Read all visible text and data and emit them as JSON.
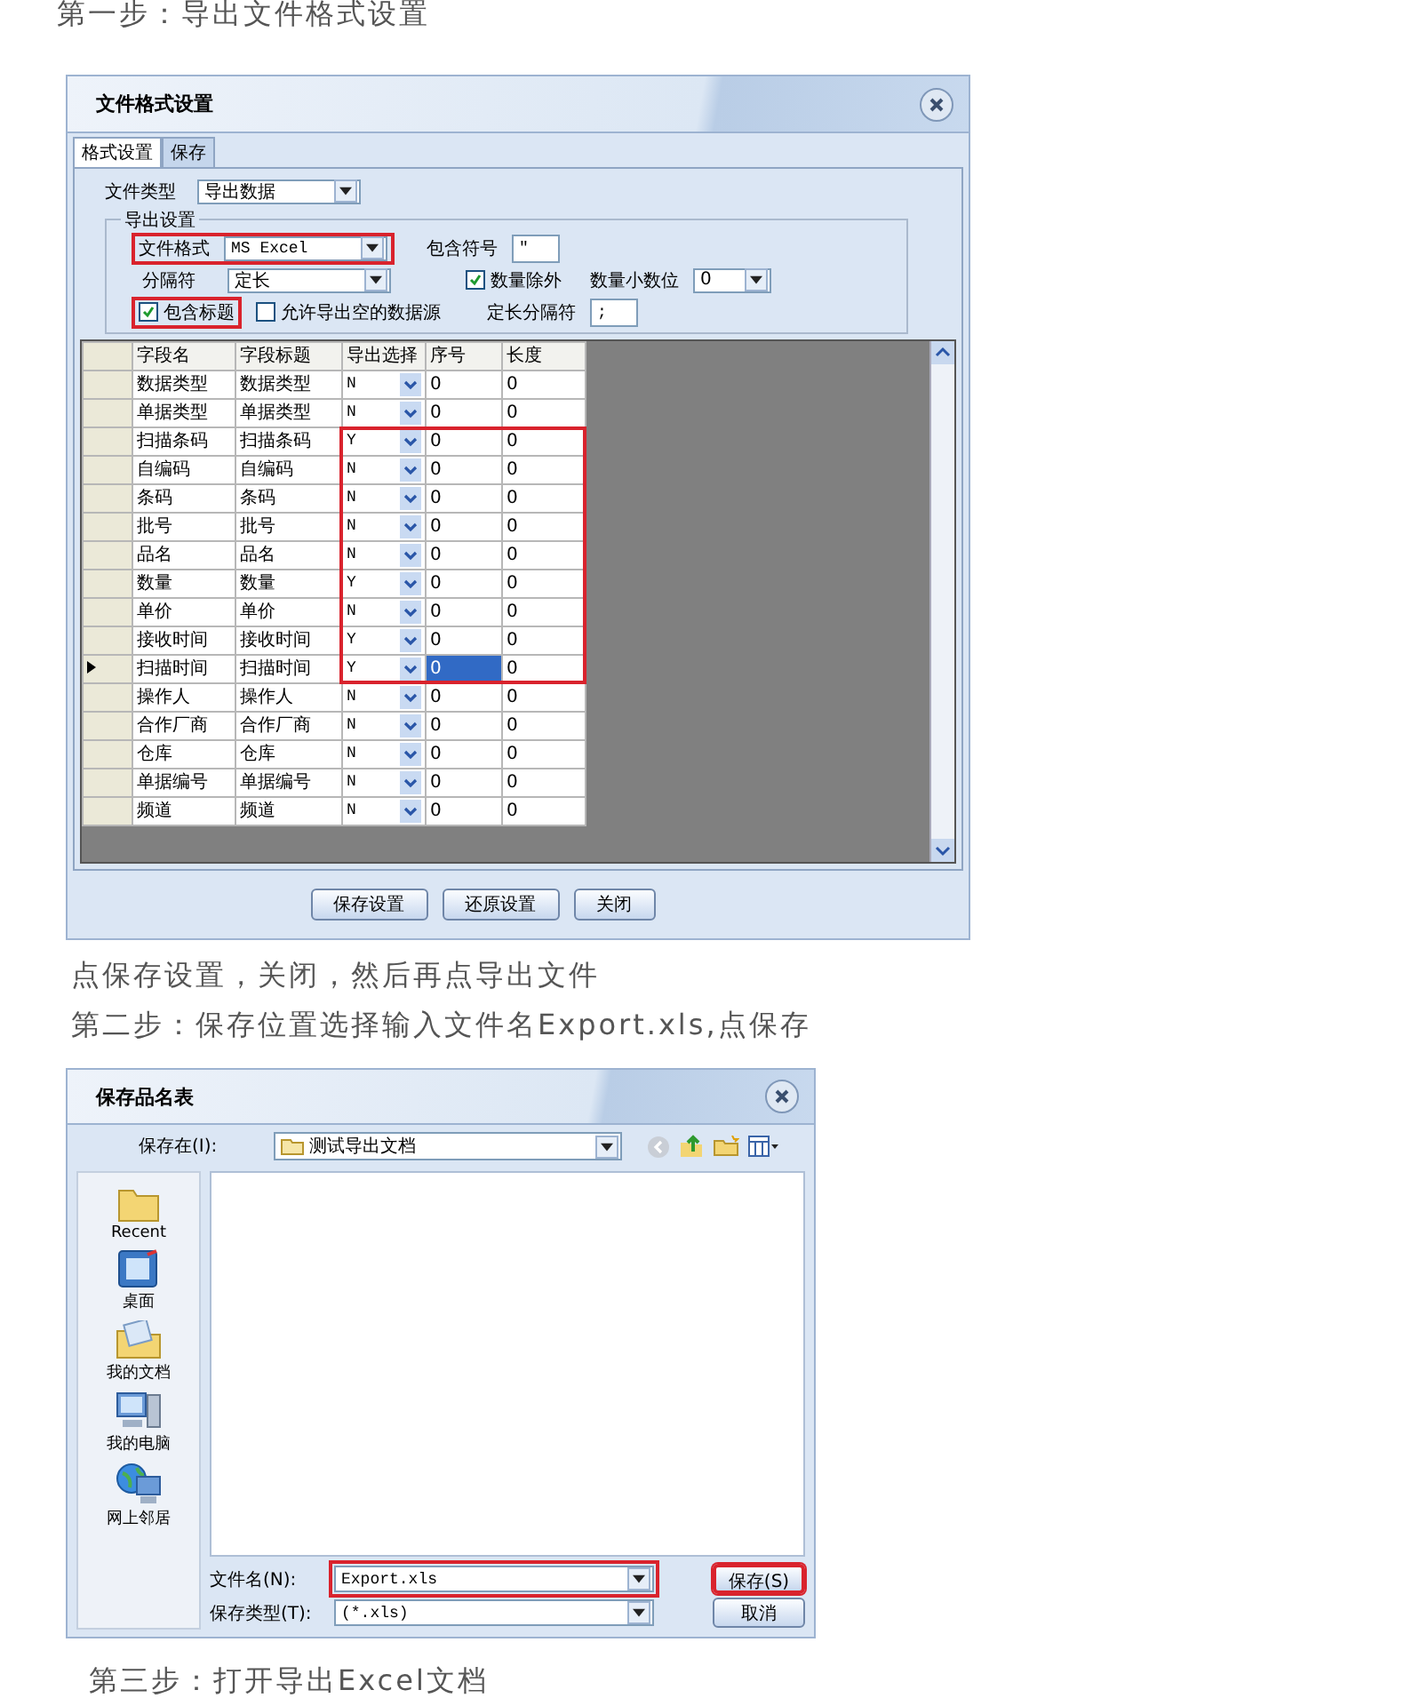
{
  "step1_heading": "第一步：导出文件格式设置",
  "export_dialog": {
    "title": "文件格式设置",
    "tabs": [
      {
        "label": "格式设置",
        "selected": true
      },
      {
        "label": "保存",
        "selected": false
      }
    ],
    "file_type": {
      "label": "文件类型",
      "value": "导出数据"
    },
    "export_settings": {
      "title": "导出设置",
      "file_format": {
        "label": "文件格式",
        "value": "MS Excel",
        "highlighted": true
      },
      "enclosure": {
        "label": "包含符号",
        "value": "\""
      },
      "separator": {
        "label": "分隔符",
        "value": "定长"
      },
      "exclude_quantity": {
        "label": "数量除外",
        "checked": true
      },
      "decimals": {
        "label": "数量小数位",
        "value": "0"
      },
      "include_header": {
        "label": "包含标题",
        "checked": true,
        "highlighted": true
      },
      "allow_empty": {
        "label": "允许导出空的数据源",
        "checked": false
      },
      "fixed_separator": {
        "label": "定长分隔符",
        "value": ";"
      }
    },
    "grid": {
      "columns": [
        "字段名",
        "字段标题",
        "导出选择",
        "序号",
        "长度"
      ],
      "rows": [
        {
          "kind": "row",
          "field": "数据类型",
          "title": "数据类型",
          "export": "N",
          "seq": "0",
          "length": "0",
          "selected": false
        },
        {
          "kind": "row",
          "field": "单据类型",
          "title": "单据类型",
          "export": "N",
          "seq": "0",
          "length": "0",
          "selected": false
        },
        {
          "kind": "highlight_group",
          "rows": [
            {
              "field": "扫描条码",
              "title": "扫描条码",
              "export": "Y",
              "seq": "0",
              "length": "0",
              "selected": false
            },
            {
              "field": "自编码",
              "title": "自编码",
              "export": "N",
              "seq": "0",
              "length": "0",
              "selected": false
            },
            {
              "field": "条码",
              "title": "条码",
              "export": "N",
              "seq": "0",
              "length": "0",
              "selected": false
            },
            {
              "field": "批号",
              "title": "批号",
              "export": "N",
              "seq": "0",
              "length": "0",
              "selected": false
            },
            {
              "field": "品名",
              "title": "品名",
              "export": "N",
              "seq": "0",
              "length": "0",
              "selected": false
            },
            {
              "field": "数量",
              "title": "数量",
              "export": "Y",
              "seq": "0",
              "length": "0",
              "selected": false
            },
            {
              "field": "单价",
              "title": "单价",
              "export": "N",
              "seq": "0",
              "length": "0",
              "selected": false
            },
            {
              "field": "接收时间",
              "title": "接收时间",
              "export": "Y",
              "seq": "0",
              "length": "0",
              "selected": false
            },
            {
              "field": "扫描时间",
              "title": "扫描时间",
              "export": "Y",
              "seq": "0",
              "length": "0",
              "selected": true
            }
          ]
        },
        {
          "kind": "row",
          "field": "操作人",
          "title": "操作人",
          "export": "N",
          "seq": "0",
          "length": "0",
          "selected": false
        },
        {
          "kind": "row",
          "field": "合作厂商",
          "title": "合作厂商",
          "export": "N",
          "seq": "0",
          "length": "0",
          "selected": false
        },
        {
          "kind": "row",
          "field": "仓库",
          "title": "仓库",
          "export": "N",
          "seq": "0",
          "length": "0",
          "selected": false
        },
        {
          "kind": "row",
          "field": "单据编号",
          "title": "单据编号",
          "export": "N",
          "seq": "0",
          "length": "0",
          "selected": false
        },
        {
          "kind": "row",
          "field": "频道",
          "title": "频道",
          "export": "N",
          "seq": "0",
          "length": "0",
          "selected": false
        }
      ]
    },
    "buttons": [
      "保存设置",
      "还原设置",
      "关闭"
    ]
  },
  "note": "点保存设置，关闭，然后再点导出文件",
  "step2_heading": "第二步：保存位置选择输入文件名Export.xls,点保存",
  "save_dialog": {
    "title": "保存品名表",
    "save_in": {
      "label": "保存在(I):",
      "value": "测试导出文档"
    },
    "places": [
      {
        "label": "Recent",
        "kind": "recent"
      },
      {
        "label": "桌面",
        "kind": "desktop"
      },
      {
        "label": "我的文档",
        "kind": "documents"
      },
      {
        "label": "我的电脑",
        "kind": "computer"
      },
      {
        "label": "网上邻居",
        "kind": "network"
      }
    ],
    "file_name": {
      "label": "文件名(N):",
      "value": "Export.xls",
      "highlighted": true
    },
    "file_type": {
      "label": "保存类型(T):",
      "value": "(*.xls)"
    },
    "buttons": [
      {
        "label": "保存(S)",
        "highlighted": true
      },
      {
        "label": "取消",
        "highlighted": false
      }
    ]
  },
  "step3_heading": "第三步：打开导出Excel文档"
}
